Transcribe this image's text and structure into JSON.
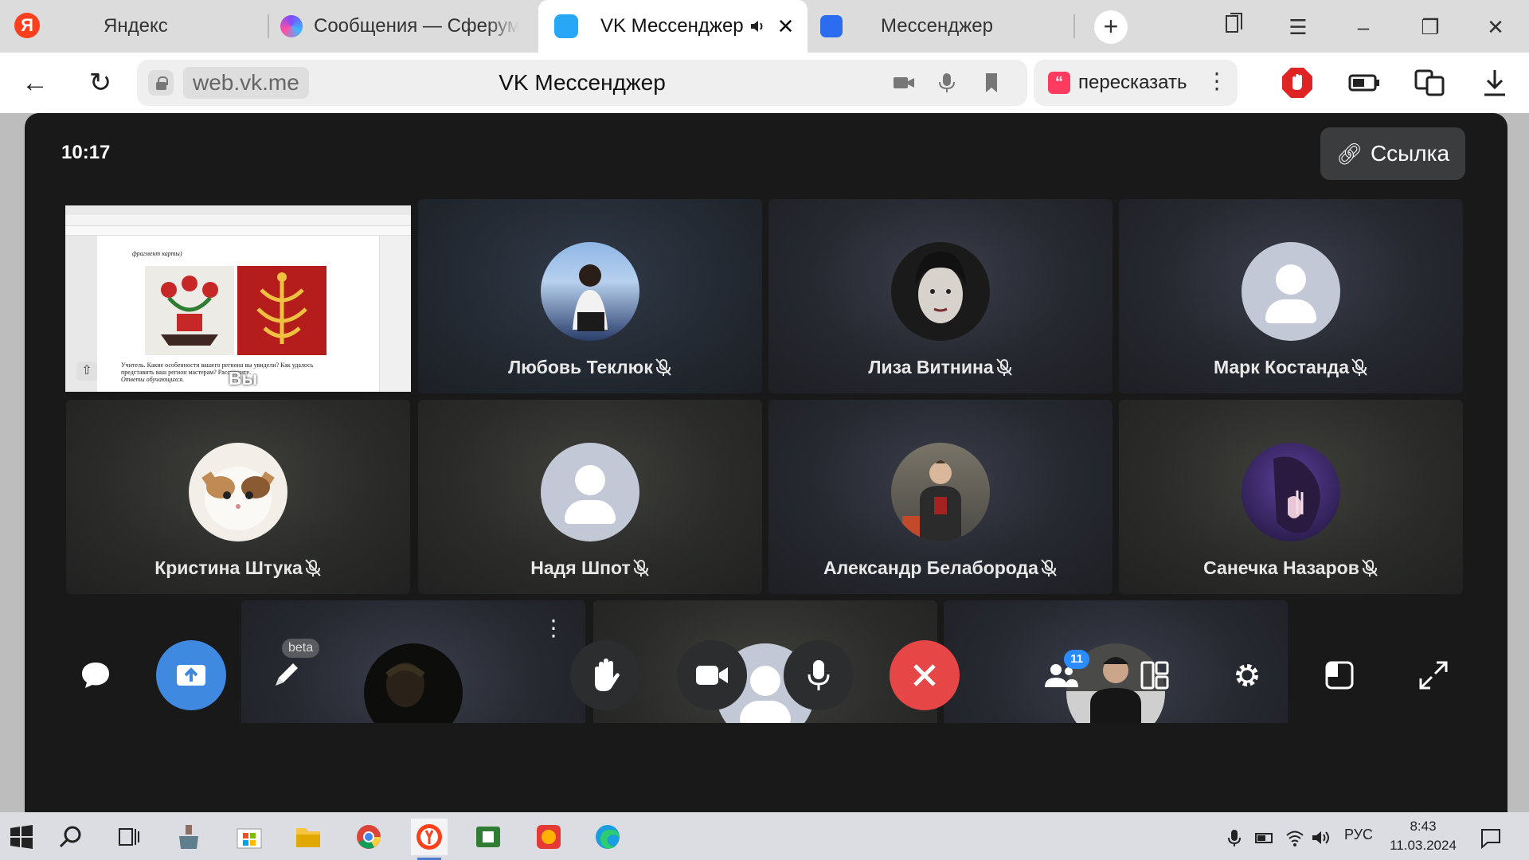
{
  "browser": {
    "tabs": [
      {
        "title": "Яндекс",
        "active": false
      },
      {
        "title": "Сообщения — Сферум",
        "active": false
      },
      {
        "title": "VK Мессенджер",
        "active": true,
        "audio": true
      },
      {
        "title": "Мессенджер",
        "active": false
      }
    ],
    "new_tab_icon": "plus-icon"
  },
  "address_bar": {
    "domain": "web.vk.me",
    "page_title": "VK Мессенджер",
    "retell_label": "пересказать"
  },
  "call": {
    "time": "10:17",
    "link_button": "Ссылка",
    "self_label": "Вы",
    "share_doc_caption": "фрагмент карты)",
    "share_doc_text_1": "Учитель. Какие особенности вашего региона вы увидели? Как удалось",
    "share_doc_text_2": "представить ваш регион мастерам? Расскажите.",
    "share_doc_text_3": "Ответы обучающихся.",
    "participants": [
      {
        "name": "Любовь Теклюк",
        "muted": true,
        "avatar": "photo"
      },
      {
        "name": "Лиза Витнина",
        "muted": true,
        "avatar": "photo"
      },
      {
        "name": "Марк Костанда",
        "muted": true,
        "avatar": "default"
      },
      {
        "name": "Кристина Штука",
        "muted": true,
        "avatar": "photo"
      },
      {
        "name": "Надя Шпот",
        "muted": true,
        "avatar": "default"
      },
      {
        "name": "Александр Белаборода",
        "muted": true,
        "avatar": "photo"
      },
      {
        "name": "Санечка Назаров",
        "muted": true,
        "avatar": "photo"
      },
      {
        "name": "",
        "muted": false,
        "avatar": "photo"
      },
      {
        "name": "",
        "muted": false,
        "avatar": "default"
      },
      {
        "name": "",
        "muted": false,
        "avatar": "photo"
      }
    ],
    "controls": {
      "beta_label": "beta",
      "participants_count": "11",
      "end_call_color": "#e64646",
      "share_color": "#3f8ae0"
    }
  },
  "taskbar": {
    "lang": "РУС",
    "time": "8:43",
    "date": "11.03.2024"
  }
}
